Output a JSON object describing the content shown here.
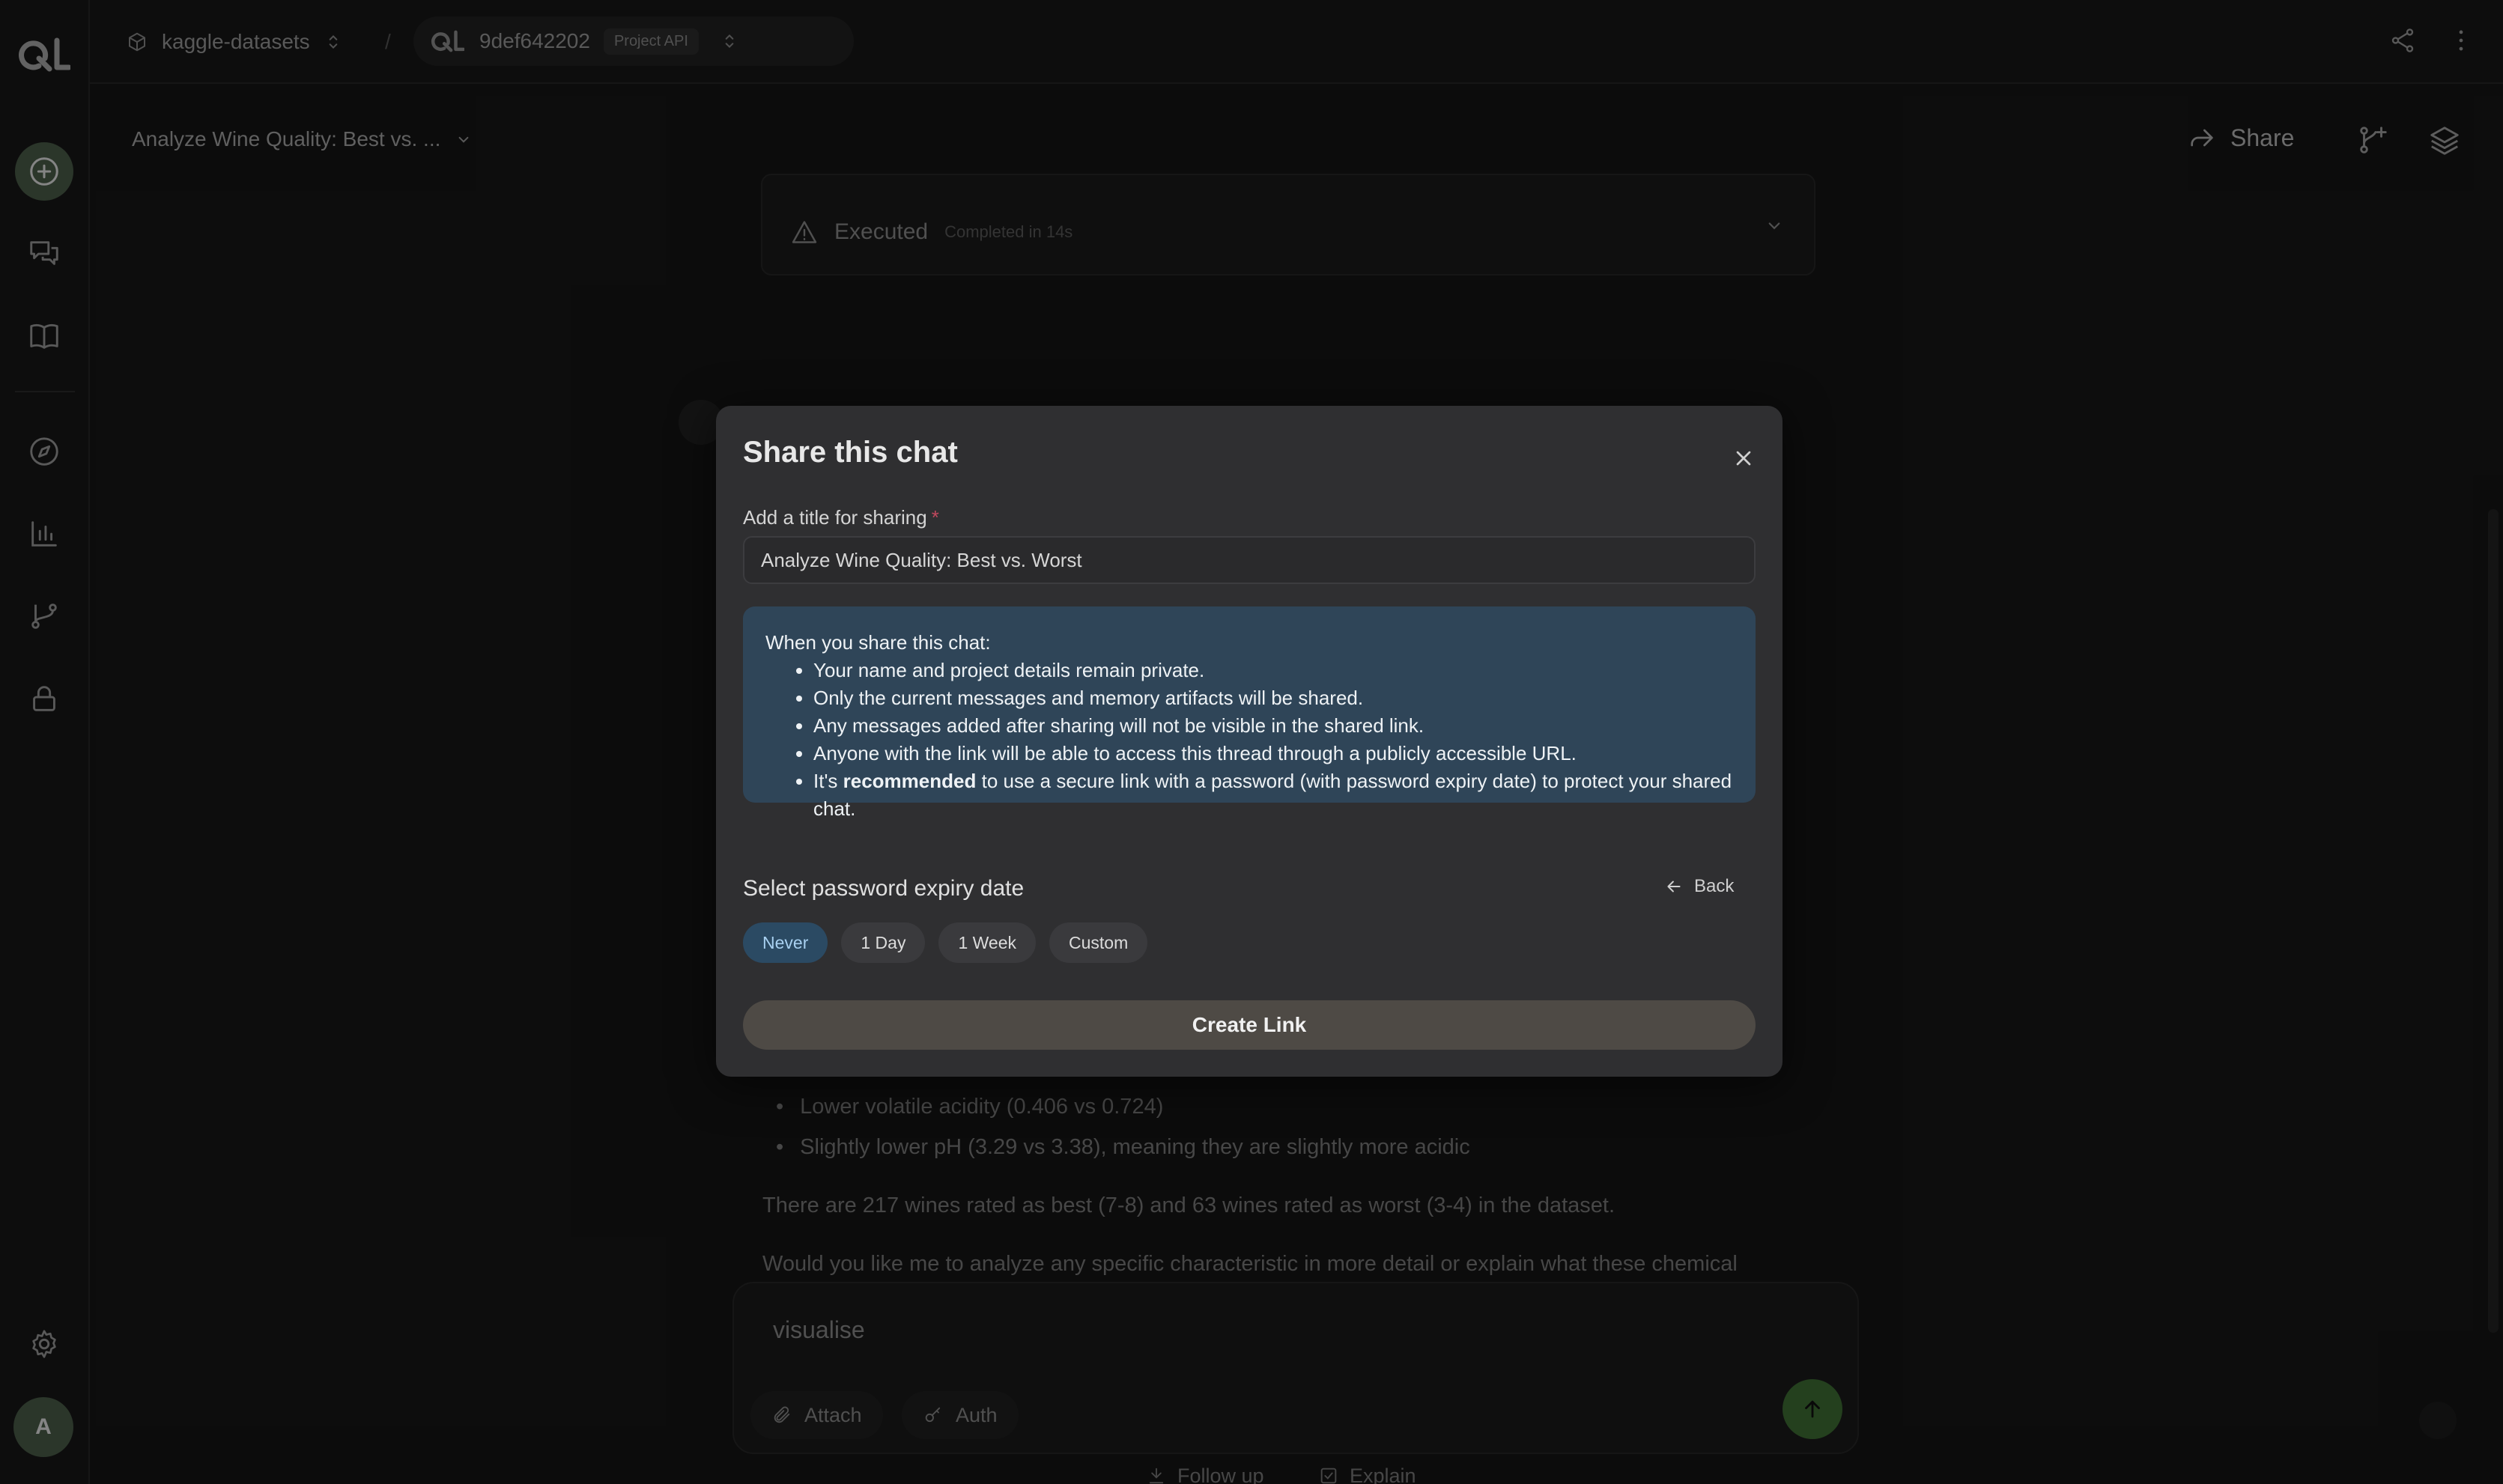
{
  "topbar": {
    "workspace": "kaggle-datasets",
    "separator": "/",
    "project_id": "9def642202",
    "project_badge": "Project API"
  },
  "subheader": {
    "chat_title": "Analyze Wine Quality: Best vs. ...",
    "share_label": "Share"
  },
  "background": {
    "exec_status": "Executed",
    "exec_time": "Completed in 14s",
    "bullets": [
      "Lower volatile acidity (0.406 vs 0.724)",
      "Slightly lower pH (3.29 vs 3.38), meaning they are slightly more acidic"
    ],
    "para1": "There are 217 wines rated as best (7-8) and 63 wines rated as worst (3-4) in the dataset.",
    "para2": "Would you like me to analyze any specific characteristic in more detail or explain what these chemical"
  },
  "composer": {
    "input_value": "visualise",
    "attach_label": "Attach",
    "auth_label": "Auth"
  },
  "suggestions": {
    "follow_up": "Follow up",
    "explain": "Explain"
  },
  "user": {
    "avatar_initial": "A"
  },
  "modal": {
    "title": "Share this chat",
    "field_label": "Add a title for sharing",
    "required_mark": "*",
    "title_value": "Analyze Wine Quality: Best vs. Worst",
    "info_intro": "When you share this chat:",
    "info_items": [
      "Your name and project details remain private.",
      "Only the current messages and memory artifacts will be shared.",
      "Any messages added after sharing will not be visible in the shared link.",
      "Anyone with the link will be able to access this thread through a publicly accessible URL."
    ],
    "info_last_pre": "It's ",
    "info_last_bold": "recommended",
    "info_last_post": " to use a secure link with a password (with password expiry date) to protect your shared chat.",
    "expiry_label": "Select password expiry date",
    "back_label": "Back",
    "expiry_options": [
      "Never",
      "1 Day",
      "1 Week",
      "Custom"
    ],
    "selected_option": "Never",
    "create_label": "Create Link"
  },
  "colors": {
    "accent_green": "#4a5d49",
    "send_green": "#3f6e35",
    "info_blue": "#2f4558",
    "chip_active": "#2b4a63",
    "required_red": "#c0485d"
  }
}
